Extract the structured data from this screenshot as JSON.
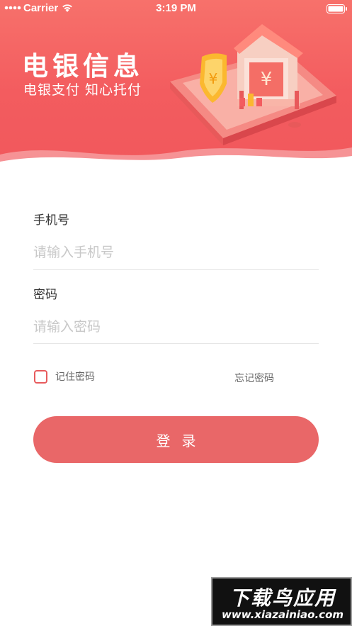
{
  "status_bar": {
    "carrier": "Carrier",
    "time": "3:19 PM"
  },
  "brand": {
    "title": "电银信息",
    "subtitle": "电银支付 知心托付"
  },
  "form": {
    "phone_label": "手机号",
    "phone_placeholder": "请输入手机号",
    "phone_value": "",
    "password_label": "密码",
    "password_placeholder": "请输入密码",
    "password_value": "",
    "remember_label": "记住密码",
    "remember_checked": false,
    "forgot_label": "忘记密码",
    "login_label": "登录"
  },
  "watermark": {
    "main": "下载鸟应用",
    "url": "www.xiazainiao.com"
  },
  "colors": {
    "header_top": "#f7716b",
    "header_bottom": "#f1585c",
    "accent": "#e96768",
    "checkbox_border": "#e75b5d",
    "placeholder": "#c8c8c8"
  }
}
